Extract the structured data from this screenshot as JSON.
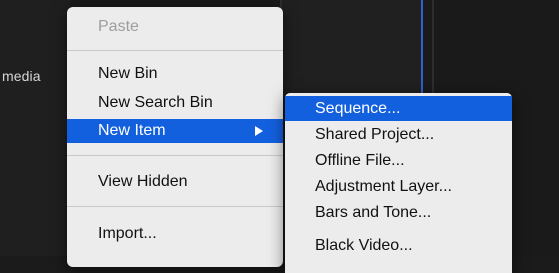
{
  "panel": {
    "label": "media"
  },
  "context_menu": {
    "items": [
      {
        "label": "Paste",
        "enabled": false
      },
      {
        "label": "New Bin",
        "enabled": true
      },
      {
        "label": "New Search Bin",
        "enabled": true
      },
      {
        "label": "New Item",
        "enabled": true,
        "highlighted": true,
        "submenu": true
      },
      {
        "label": "View Hidden",
        "enabled": true
      },
      {
        "label": "Import...",
        "enabled": true
      }
    ]
  },
  "submenu": {
    "items": [
      {
        "label": "Sequence...",
        "highlighted": true
      },
      {
        "label": "Shared Project..."
      },
      {
        "label": "Offline File..."
      },
      {
        "label": "Adjustment Layer..."
      },
      {
        "label": "Bars and Tone..."
      },
      {
        "label": "Black Video..."
      }
    ]
  },
  "colors": {
    "highlight": "#1360df",
    "menu_bg": "#ececec",
    "timeline_marker": "#2f5fd1"
  }
}
